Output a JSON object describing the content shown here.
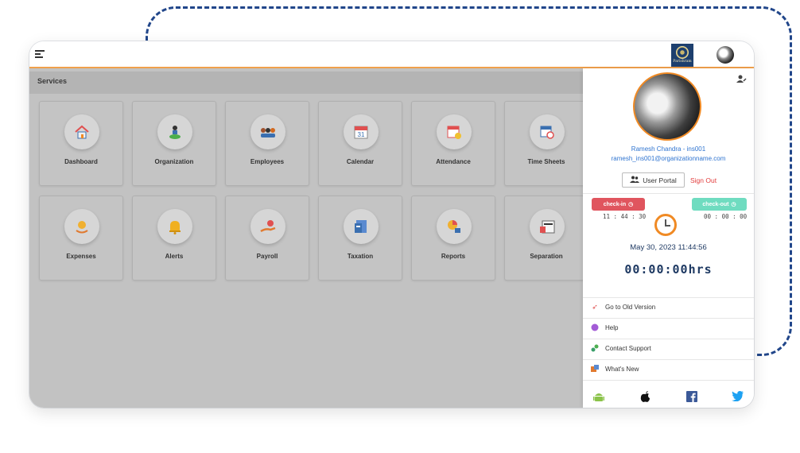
{
  "header": {
    "brand_text": "Parishram"
  },
  "services": {
    "title": "Services",
    "tiles": [
      {
        "label": "Dashboard",
        "icon": "house-icon"
      },
      {
        "label": "Organization",
        "icon": "organization-icon"
      },
      {
        "label": "Employees",
        "icon": "employees-icon"
      },
      {
        "label": "Calendar",
        "icon": "calendar-icon"
      },
      {
        "label": "Attendance",
        "icon": "attendance-icon"
      },
      {
        "label": "Time Sheets",
        "icon": "timesheet-icon"
      },
      {
        "label": "Expenses",
        "icon": "expenses-icon"
      },
      {
        "label": "Alerts",
        "icon": "bell-icon"
      },
      {
        "label": "Payroll",
        "icon": "payroll-icon"
      },
      {
        "label": "Taxation",
        "icon": "taxation-icon"
      },
      {
        "label": "Reports",
        "icon": "reports-icon"
      },
      {
        "label": "Separation",
        "icon": "notice-icon"
      }
    ],
    "calendar_day": "31"
  },
  "profile": {
    "name": "Ramesh Chandra - ins001",
    "email": "ramesh_ins001@organizationname.com",
    "portal_label": "User Portal",
    "signout_label": "Sign Out"
  },
  "attendance": {
    "checkin_label": "check-in",
    "checkout_label": "check-out",
    "checkin_time": "11 : 44 : 30",
    "checkout_time": "00 : 00 : 00",
    "date_time": "May 30, 2023 11:44:56",
    "hours": "00:00:00hrs"
  },
  "menu": [
    {
      "label": "Go to Old Version",
      "icon": "rocket-icon"
    },
    {
      "label": "Help",
      "icon": "help-icon"
    },
    {
      "label": "Contact Support",
      "icon": "support-icon"
    },
    {
      "label": "What's New",
      "icon": "whats-new-icon"
    }
  ],
  "colors": {
    "accent": "#f08a24",
    "link": "#2f74d0",
    "checkin": "#e0555e",
    "checkout": "#6fdcc0",
    "dash_border": "#21468a"
  }
}
